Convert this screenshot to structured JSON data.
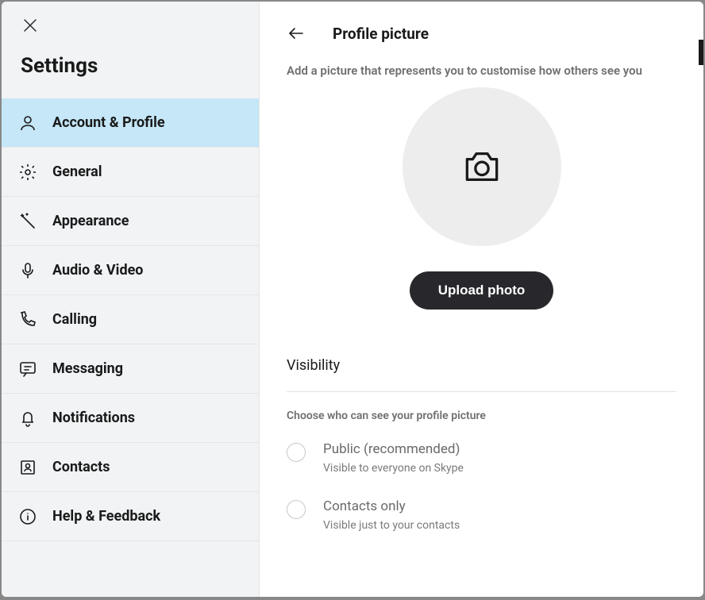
{
  "sidebar": {
    "title": "Settings",
    "items": [
      {
        "label": "Account & Profile"
      },
      {
        "label": "General"
      },
      {
        "label": "Appearance"
      },
      {
        "label": "Audio & Video"
      },
      {
        "label": "Calling"
      },
      {
        "label": "Messaging"
      },
      {
        "label": "Notifications"
      },
      {
        "label": "Contacts"
      },
      {
        "label": "Help & Feedback"
      }
    ]
  },
  "content": {
    "title": "Profile picture",
    "subtitle": "Add a picture that represents you to customise how others see you",
    "upload_label": "Upload photo",
    "visibility": {
      "section_label": "Visibility",
      "hint": "Choose who can see your profile picture",
      "options": [
        {
          "title": "Public (recommended)",
          "desc": "Visible to everyone on Skype"
        },
        {
          "title": "Contacts only",
          "desc": "Visible just to your contacts"
        }
      ]
    }
  }
}
